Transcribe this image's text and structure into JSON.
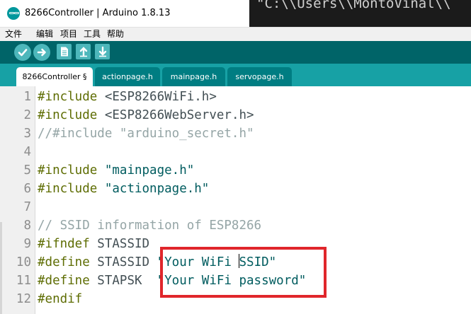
{
  "window": {
    "title": "8266Controller | Arduino 1.8.13",
    "background_text": "\"C:\\\\Users\\\\MontoVinal\\\\"
  },
  "menu": [
    "文件",
    "编辑",
    "项目",
    "工具",
    "帮助"
  ],
  "toolbar": {
    "buttons": [
      {
        "name": "verify",
        "icon": "checkmark-icon"
      },
      {
        "name": "upload",
        "icon": "arrow-right-icon"
      },
      {
        "name": "new",
        "icon": "document-icon"
      },
      {
        "name": "open",
        "icon": "arrow-up-icon"
      },
      {
        "name": "save",
        "icon": "arrow-down-icon"
      }
    ]
  },
  "tabs": [
    {
      "label": "8266Controller §",
      "active": true
    },
    {
      "label": "actionpage.h",
      "active": false
    },
    {
      "label": "mainpage.h",
      "active": false
    },
    {
      "label": "servopage.h",
      "active": false
    }
  ],
  "editor": {
    "lines": [
      {
        "n": "1",
        "kw": "#include",
        "rest": " <ESP8266WiFi.h>"
      },
      {
        "n": "2",
        "kw": "#include",
        "rest": " <ESP8266WebServer.h>"
      },
      {
        "n": "3",
        "comment": "//#include \"arduino_secret.h\""
      },
      {
        "n": "4"
      },
      {
        "n": "5",
        "kw": "#include",
        "str": " \"mainpage.h\""
      },
      {
        "n": "6",
        "kw": "#include",
        "str": " \"actionpage.h\""
      },
      {
        "n": "7"
      },
      {
        "n": "8",
        "comment": "// SSID information of ESP8266"
      },
      {
        "n": "9",
        "kw": "#ifndef",
        "rest": " STASSID"
      },
      {
        "n": "10",
        "kw": "#define",
        "rest": " STASSID ",
        "str_a": "\"Your WiFi ",
        "str_b": "SSID\""
      },
      {
        "n": "11",
        "kw": "#define",
        "rest": " STAPSK  ",
        "str": "\"Your WiFi password\""
      },
      {
        "n": "12",
        "kw": "#endif"
      }
    ]
  },
  "colors": {
    "toolbar": "#006468",
    "tabbar": "#17a1a5",
    "keyword": "#5e6d03",
    "string": "#005c5f",
    "comment": "#95a5a6",
    "highlight": "#e0262b"
  }
}
